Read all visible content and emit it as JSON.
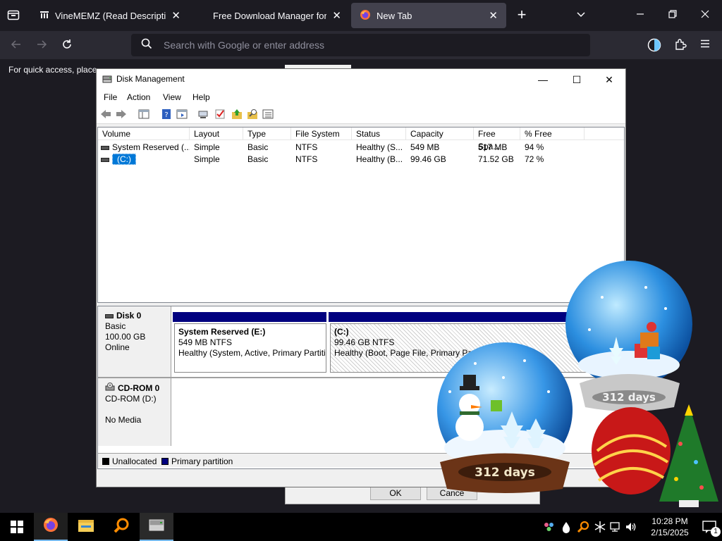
{
  "browser": {
    "tabs": [
      {
        "title": "VineMEMZ (Read Description) :",
        "active": false
      },
      {
        "title": "Free Download Manager for Wi",
        "active": false
      },
      {
        "title": "New Tab",
        "active": true
      }
    ],
    "new_tab_symbol": "+",
    "url_placeholder": "Search with Google or enter address",
    "bookmark_notice": "For quick access, place"
  },
  "disk_management": {
    "title": "Disk Management",
    "menu": [
      "File",
      "Action",
      "View",
      "Help"
    ],
    "columns": [
      "Volume",
      "Layout",
      "Type",
      "File System",
      "Status",
      "Capacity",
      "Free Spa...",
      "% Free"
    ],
    "rows": [
      [
        "System Reserved (...",
        "Simple",
        "Basic",
        "NTFS",
        "Healthy (S...",
        "549 MB",
        "517 MB",
        "94 %"
      ],
      [
        "(C:)",
        "Simple",
        "Basic",
        "NTFS",
        "Healthy (B...",
        "99.46 GB",
        "71.52 GB",
        "72 %"
      ]
    ],
    "disks": [
      {
        "name": "Disk 0",
        "type": "Basic",
        "size": "100.00 GB",
        "state": "Online",
        "partitions": [
          {
            "label": "System Reserved  (E:)",
            "fs": "549 MB NTFS",
            "status": "Healthy (System, Active, Primary Partiti"
          },
          {
            "label": "(C:)",
            "fs": "99.46 GB NTFS",
            "status": "Healthy (Boot, Page File, Primary Part"
          }
        ]
      },
      {
        "name": "CD-ROM 0",
        "type": "CD-ROM (D:)",
        "size": "",
        "state": "No Media"
      }
    ],
    "legend": [
      {
        "label": "Unallocated",
        "color": "#000000"
      },
      {
        "label": "Primary partition",
        "color": "#00007f"
      }
    ]
  },
  "background_dialog": {
    "ok_label": "OK",
    "cancel_label": "Cance"
  },
  "overlay": {
    "front_globe_text": "312 days",
    "back_globe_text": "312 days"
  },
  "taskbar": {
    "apps": [
      "firefox",
      "file-explorer",
      "search-app",
      "disk-management"
    ],
    "clock_time": "10:28 PM",
    "clock_date": "2/15/2025",
    "notification_count": "1"
  },
  "colors": {
    "primary_partition": "#00007f",
    "accent_firefox": "#ff7139"
  }
}
